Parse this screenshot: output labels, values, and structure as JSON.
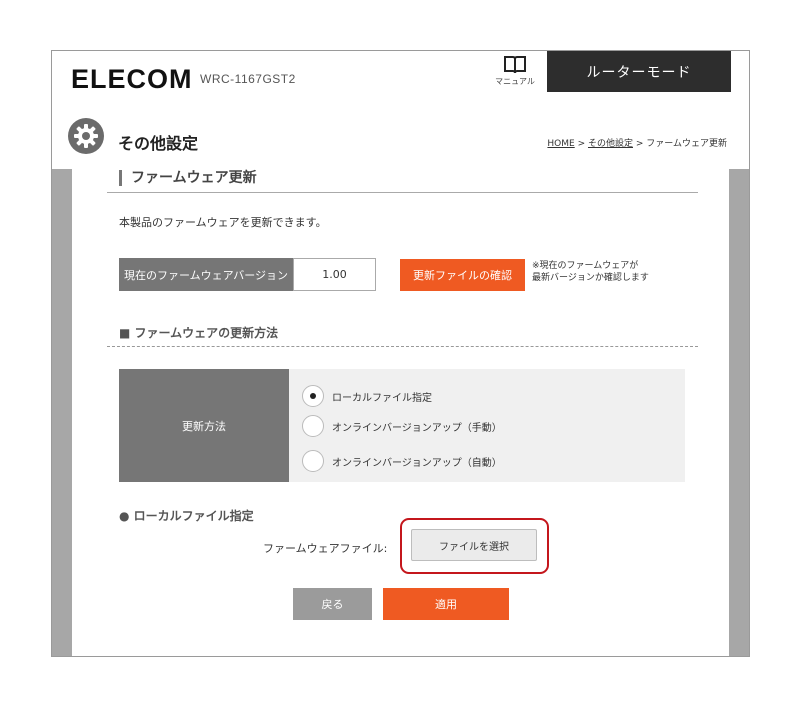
{
  "header": {
    "logo": "ELECOM",
    "model": "WRC-1167GST2",
    "manual_label": "マニュアル",
    "mode_tab": "ルーターモード"
  },
  "page": {
    "title": "その他設定",
    "breadcrumb": {
      "home": "HOME",
      "sep1": " > ",
      "parent": "その他設定",
      "sep2": " > ",
      "current": "ファームウェア更新"
    }
  },
  "section": {
    "title": "ファームウェア更新",
    "description": "本製品のファームウェアを更新できます。"
  },
  "firmware": {
    "version_label": "現在のファームウェアバージョン",
    "version_value": "1.00",
    "check_button": "更新ファイルの確認",
    "note_line1": "※現在のファームウェアが",
    "note_line2": "最新バージョンか確認します"
  },
  "update_method": {
    "title": "■ ファームウェアの更新方法",
    "label": "更新方法",
    "options": [
      {
        "label": "ローカルファイル指定",
        "selected": true
      },
      {
        "label": "オンラインバージョンアップ（手動）",
        "selected": false
      },
      {
        "label": "オンラインバージョンアップ（自動）",
        "selected": false
      }
    ]
  },
  "local_file": {
    "title": "● ローカルファイル指定",
    "file_label": "ファームウェアファイル:",
    "select_button": "ファイルを選択"
  },
  "actions": {
    "back": "戻る",
    "apply": "適用"
  },
  "colors": {
    "accent": "#ef5a22",
    "header_tab": "#2d2d2d",
    "label_bg": "#767676",
    "highlight": "#c4161c"
  }
}
